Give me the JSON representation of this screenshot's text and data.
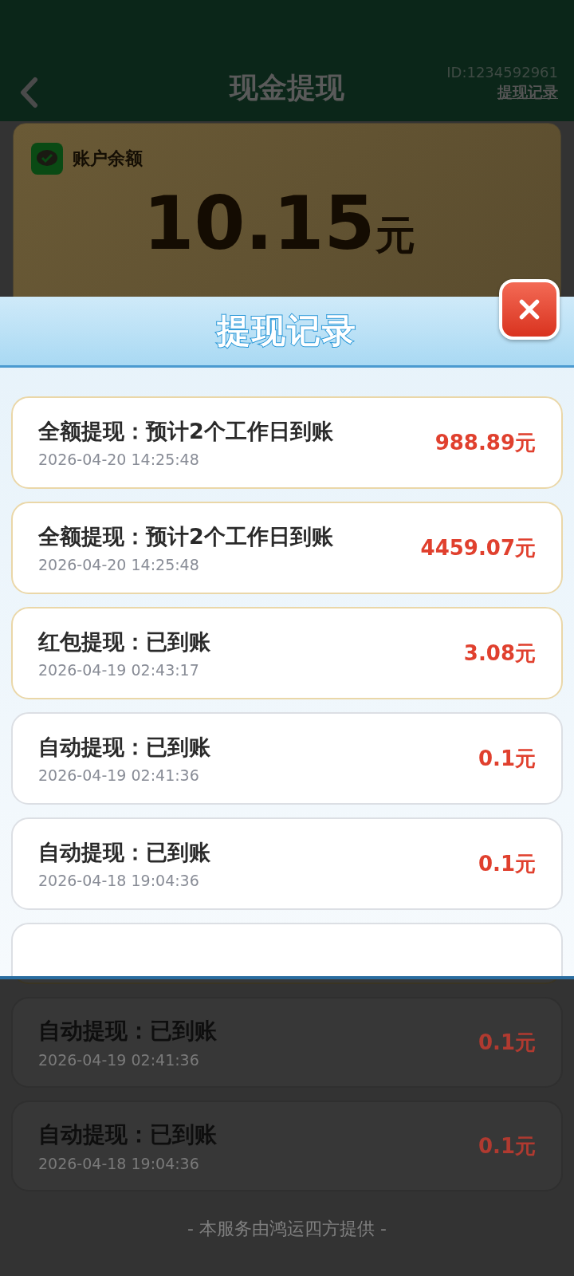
{
  "page": {
    "title": "现金提现",
    "user_id": "ID:1234592961",
    "records_link": "提现记录"
  },
  "balance": {
    "label": "账户余额",
    "amount": "10.15",
    "unit": "元"
  },
  "background_records": [
    {
      "title": "自动提现：已到账",
      "date": "2026-04-19 02:41:36",
      "amount": "0.1元"
    },
    {
      "title": "自动提现：已到账",
      "date": "2026-04-18 19:04:36",
      "amount": "0.1元"
    }
  ],
  "footer": "- 本服务由鸿运四方提供 -",
  "dialog": {
    "title": "提现记录",
    "records": [
      {
        "title": "全额提现：预计2个工作日到账",
        "date": "2026-04-20 14:25:48",
        "amount": "988.89元",
        "highlighted": true
      },
      {
        "title": "全额提现：预计2个工作日到账",
        "date": "2026-04-20 14:25:48",
        "amount": "4459.07元",
        "highlighted": true
      },
      {
        "title": "红包提现：已到账",
        "date": "2026-04-19 02:43:17",
        "amount": "3.08元",
        "highlighted": true
      },
      {
        "title": "自动提现：已到账",
        "date": "2026-04-19 02:41:36",
        "amount": "0.1元",
        "highlighted": false
      },
      {
        "title": "自动提现：已到账",
        "date": "2026-04-18 19:04:36",
        "amount": "0.1元",
        "highlighted": false
      }
    ]
  }
}
